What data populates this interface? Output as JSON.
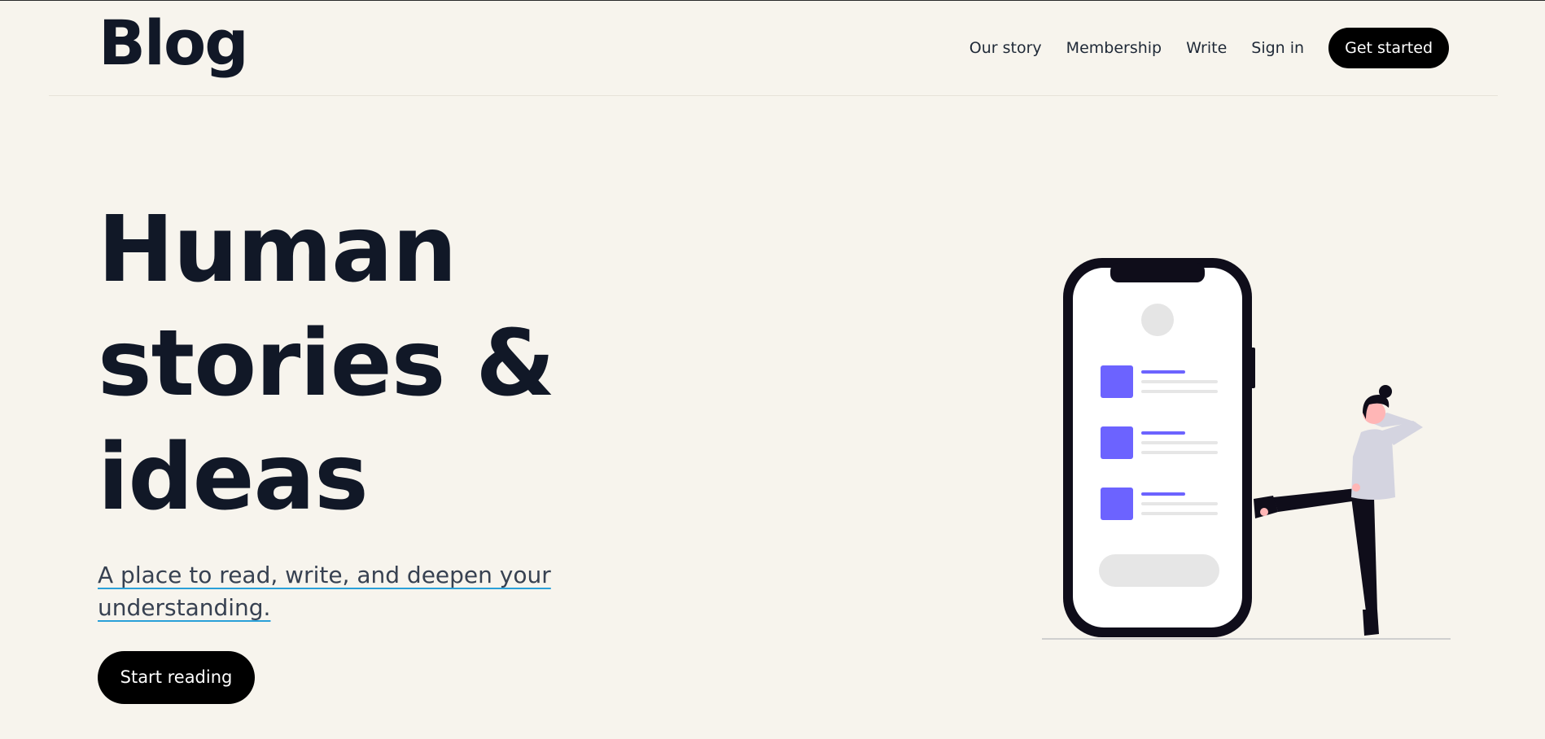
{
  "header": {
    "logo": "Blog",
    "nav": [
      {
        "label": "Our story"
      },
      {
        "label": "Membership"
      },
      {
        "label": "Write"
      },
      {
        "label": "Sign in"
      }
    ],
    "cta_label": "Get started"
  },
  "hero": {
    "title_lines": [
      "Human",
      "stories &",
      "ideas"
    ],
    "subtitle": "A place to read, write, and deepen your understanding.",
    "cta_label": "Start reading"
  },
  "colors": {
    "background": "#f7f4ed",
    "text": "#111827",
    "button": "#000000",
    "accent": "#6c63ff",
    "underline": "#2aa0d8"
  },
  "illustration": {
    "icon": "phone-person-illustration"
  }
}
